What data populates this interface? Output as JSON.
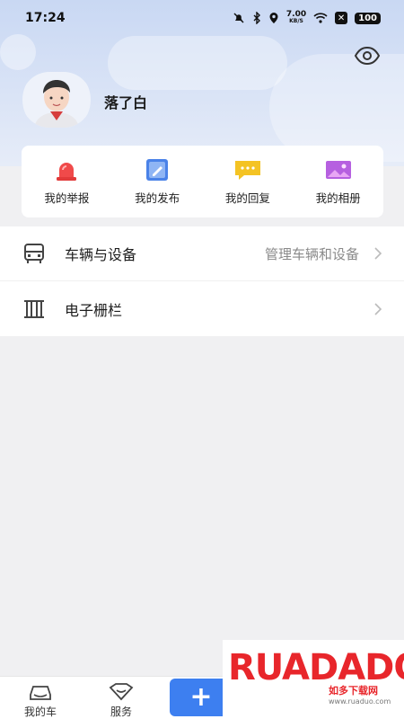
{
  "status_bar": {
    "time": "17:24",
    "net_speed": "7.00",
    "net_unit": "KB/S",
    "battery": "100"
  },
  "profile": {
    "username": "落了白"
  },
  "quick_actions": [
    {
      "label": "我的举报",
      "icon": "alarm-icon"
    },
    {
      "label": "我的发布",
      "icon": "edit-icon"
    },
    {
      "label": "我的回复",
      "icon": "chat-icon"
    },
    {
      "label": "我的相册",
      "icon": "album-icon"
    }
  ],
  "menu": [
    {
      "title": "车辆与设备",
      "subtitle": "管理车辆和设备",
      "icon": "vehicle-icon"
    },
    {
      "title": "电子栅栏",
      "subtitle": "",
      "icon": "fence-icon"
    }
  ],
  "tabbar": {
    "tabs": [
      {
        "label": "我的车",
        "icon": "car-icon"
      },
      {
        "label": "服务",
        "icon": "service-icon"
      }
    ],
    "add_label": "+"
  },
  "watermark": {
    "brand": "RUADADO",
    "sub": "如多下载网",
    "url": "www.ruaduo.com"
  },
  "colors": {
    "accent": "#3d7ff0",
    "header_bg": "#d3dff5",
    "watermark_red": "#e8262b"
  }
}
